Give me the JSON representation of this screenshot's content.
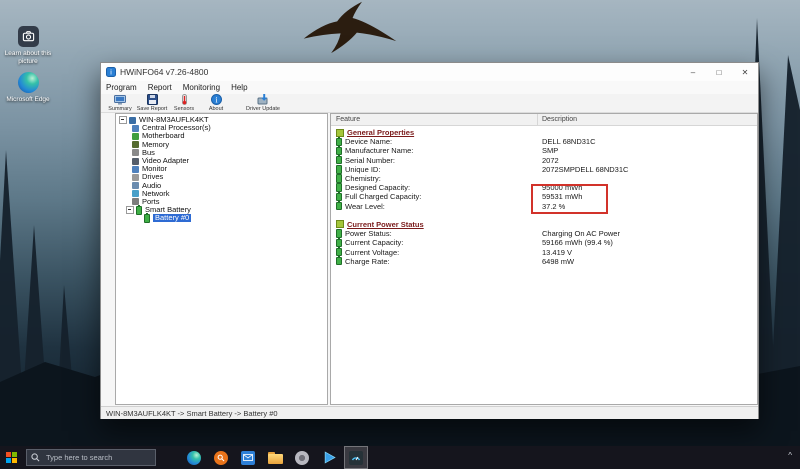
{
  "desktop": {
    "icons": [
      {
        "label": "Learn about this picture"
      },
      {
        "label": "Microsoft Edge"
      }
    ]
  },
  "window": {
    "title": "HWiNFO64 v7.26-4800",
    "controls": {
      "minimize": "–",
      "maximize": "□",
      "close": "✕"
    },
    "menu": [
      "Program",
      "Report",
      "Monitoring",
      "Help"
    ],
    "toolbar": [
      {
        "label": "Summary"
      },
      {
        "label": "Save Report"
      },
      {
        "label": "Sensors"
      },
      {
        "label": "About"
      },
      {
        "label": "Driver Update"
      }
    ],
    "tree": {
      "root": "WIN-8M3AUFLK4KT",
      "items": [
        "Central Processor(s)",
        "Motherboard",
        "Memory",
        "Bus",
        "Video Adapter",
        "Monitor",
        "Drives",
        "Audio",
        "Network",
        "Ports",
        "Smart Battery"
      ],
      "selected": "Battery #0"
    },
    "table": {
      "columns": [
        "Feature",
        "Description"
      ],
      "sections": [
        {
          "title": "General Properties",
          "rows": [
            {
              "feature": "Device Name:",
              "description": "DELL 68ND31C"
            },
            {
              "feature": "Manufacturer Name:",
              "description": "SMP"
            },
            {
              "feature": "Serial Number:",
              "description": "2072"
            },
            {
              "feature": "Unique ID:",
              "description": "2072SMPDELL 68ND31C"
            },
            {
              "feature": "Chemistry:",
              "description": ""
            },
            {
              "feature": "Designed Capacity:",
              "description": "95000 mWh"
            },
            {
              "feature": "Full Charged Capacity:",
              "description": "59531 mWh"
            },
            {
              "feature": "Wear Level:",
              "description": "37.2 %"
            }
          ]
        },
        {
          "title": "Current Power Status",
          "rows": [
            {
              "feature": "Power Status:",
              "description": "Charging On AC Power"
            },
            {
              "feature": "Current Capacity:",
              "description": "59166 mWh (99.4 %)"
            },
            {
              "feature": "Current Voltage:",
              "description": "13.419 V"
            },
            {
              "feature": "Charge Rate:",
              "description": "6498 mW"
            }
          ]
        }
      ]
    },
    "status_bar": "WIN-8M3AUFLK4KT -> Smart Battery -> Battery #0"
  },
  "taskbar": {
    "search_placeholder": "Type here to search",
    "tray_chevron": "^"
  },
  "colors": {
    "selection_blue": "#2e6bd3",
    "highlight_red": "#d2322a",
    "section_title_maroon": "#7a1a1a",
    "battery_green": "#3faf46"
  },
  "icons": {
    "desktop": [
      "spotlight-camera-icon",
      "edge-icon"
    ],
    "toolbar": [
      "summary-monitor-icon",
      "save-floppy-icon",
      "sensors-thermometer-icon",
      "about-info-icon",
      "driver-update-icon"
    ],
    "tree": [
      "computer-icon",
      "cpu-icon",
      "motherboard-icon",
      "memory-icon",
      "bus-icon",
      "video-adapter-icon",
      "monitor-icon",
      "drives-icon",
      "audio-icon",
      "network-icon",
      "ports-icon",
      "battery-icon"
    ],
    "taskbar": [
      "start-icon",
      "search-icon",
      "edge-icon",
      "search-app-icon",
      "mail-icon",
      "file-explorer-icon",
      "settings-icon",
      "media-player-icon",
      "hwinfo-icon",
      "tray-chevron-icon"
    ]
  }
}
